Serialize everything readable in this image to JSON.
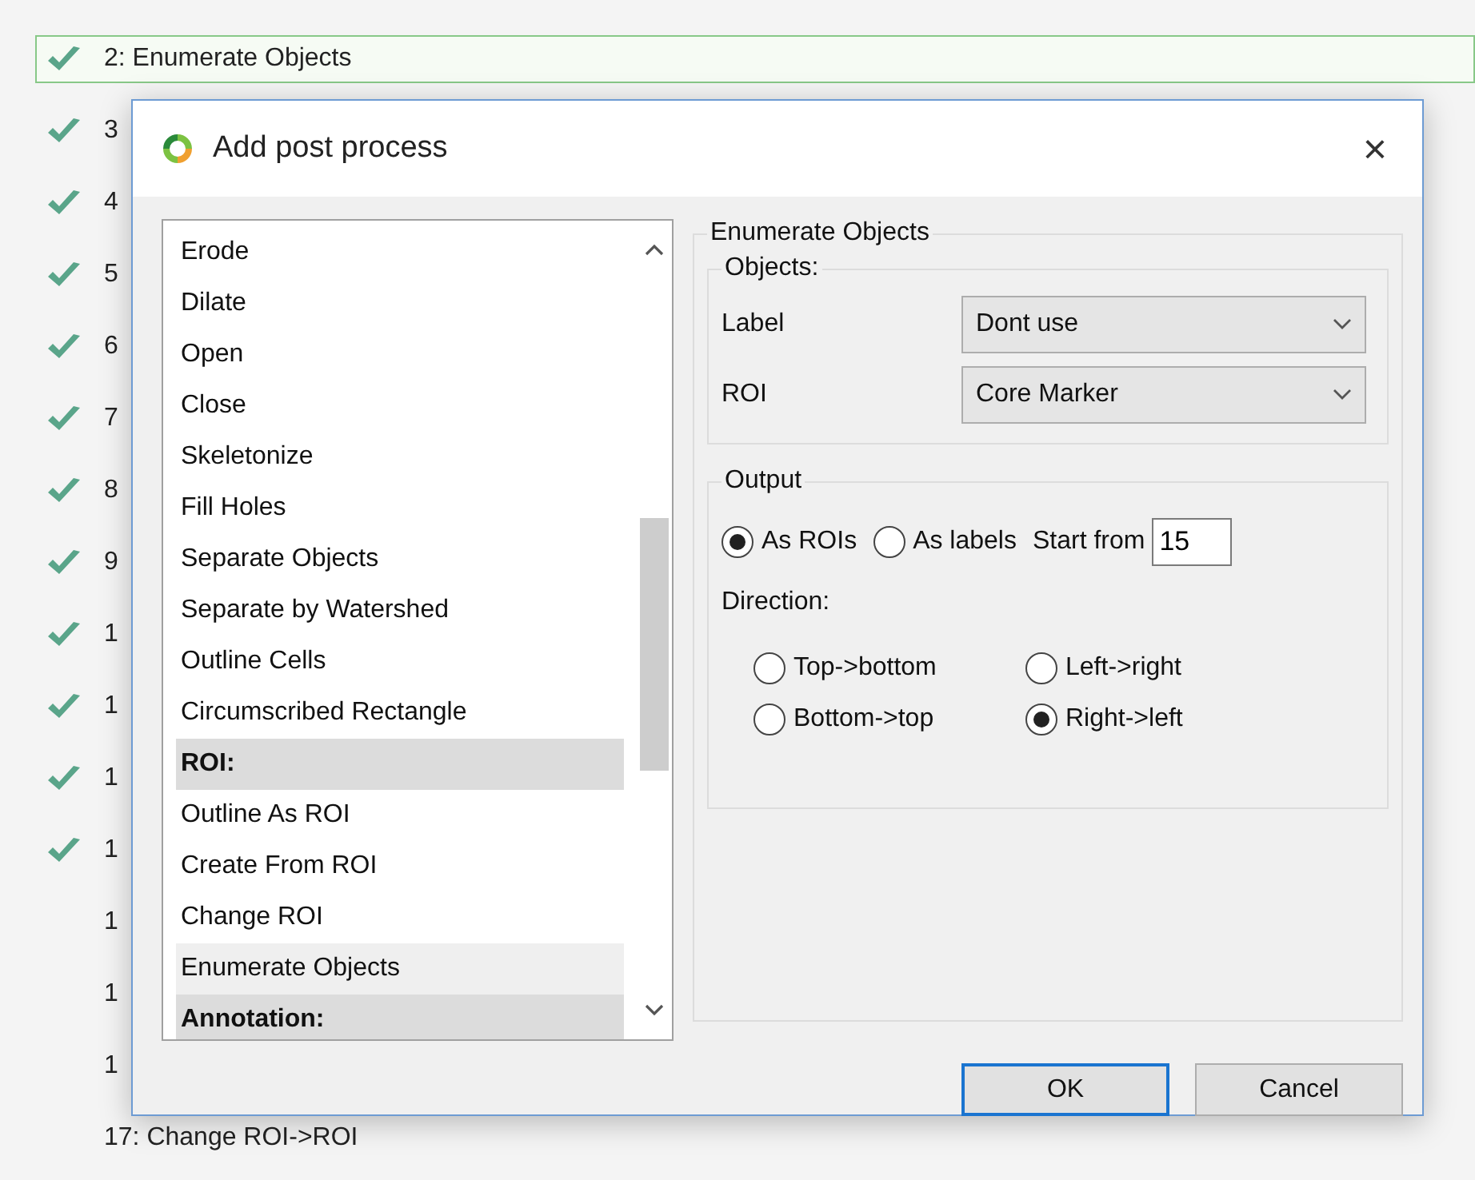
{
  "steps": [
    {
      "label": "2: Enumerate Objects",
      "done": true,
      "selected": true
    },
    {
      "label": "3",
      "done": true,
      "selected": false
    },
    {
      "label": "4",
      "done": true,
      "selected": false
    },
    {
      "label": "5",
      "done": true,
      "selected": false
    },
    {
      "label": "6",
      "done": true,
      "selected": false
    },
    {
      "label": "7",
      "done": true,
      "selected": false
    },
    {
      "label": "8",
      "done": true,
      "selected": false
    },
    {
      "label": "9",
      "done": true,
      "selected": false
    },
    {
      "label": "1",
      "done": true,
      "selected": false
    },
    {
      "label": "1",
      "done": true,
      "selected": false
    },
    {
      "label": "1",
      "done": true,
      "selected": false
    },
    {
      "label": "1",
      "done": true,
      "selected": false
    },
    {
      "label": "1",
      "done": false,
      "selected": false
    },
    {
      "label": "1",
      "done": false,
      "selected": false
    },
    {
      "label": "1",
      "done": false,
      "selected": false
    },
    {
      "label": "17: Change ROI->ROI",
      "done": false,
      "selected": false
    }
  ],
  "dialog": {
    "title": "Add post process",
    "close": "×",
    "list": [
      {
        "kind": "item",
        "label": "Erode",
        "selected": false
      },
      {
        "kind": "item",
        "label": "Dilate",
        "selected": false
      },
      {
        "kind": "item",
        "label": "Open",
        "selected": false
      },
      {
        "kind": "item",
        "label": "Close",
        "selected": false
      },
      {
        "kind": "item",
        "label": "Skeletonize",
        "selected": false
      },
      {
        "kind": "item",
        "label": "Fill Holes",
        "selected": false
      },
      {
        "kind": "item",
        "label": "Separate Objects",
        "selected": false
      },
      {
        "kind": "item",
        "label": "Separate by Watershed",
        "selected": false
      },
      {
        "kind": "item",
        "label": "Outline Cells",
        "selected": false
      },
      {
        "kind": "item",
        "label": "Circumscribed Rectangle",
        "selected": false
      },
      {
        "kind": "header",
        "label": "ROI:"
      },
      {
        "kind": "item",
        "label": "Outline As ROI",
        "selected": false
      },
      {
        "kind": "item",
        "label": "Create From ROI",
        "selected": false
      },
      {
        "kind": "item",
        "label": "Change ROI",
        "selected": false
      },
      {
        "kind": "item",
        "label": "Enumerate Objects",
        "selected": true
      },
      {
        "kind": "header",
        "label": "Annotation:"
      }
    ],
    "panel": {
      "title": "Enumerate Objects",
      "objects": {
        "title": "Objects:",
        "fields": [
          {
            "label": "Label",
            "value": "Dont use"
          },
          {
            "label": "ROI",
            "value": "Core Marker"
          }
        ]
      },
      "output": {
        "title": "Output",
        "modes": [
          {
            "label": "As ROIs",
            "selected": true
          },
          {
            "label": "As labels",
            "selected": false
          }
        ],
        "start_label": "Start from",
        "start_value": "15",
        "direction_label": "Direction:",
        "directions": [
          {
            "label": "Top->bottom",
            "selected": false
          },
          {
            "label": "Left->right",
            "selected": false
          },
          {
            "label": "Bottom->top",
            "selected": false
          },
          {
            "label": "Right->left",
            "selected": true
          }
        ]
      }
    },
    "buttons": [
      {
        "label": "OK",
        "default": true
      },
      {
        "label": "Cancel",
        "default": false
      }
    ]
  }
}
